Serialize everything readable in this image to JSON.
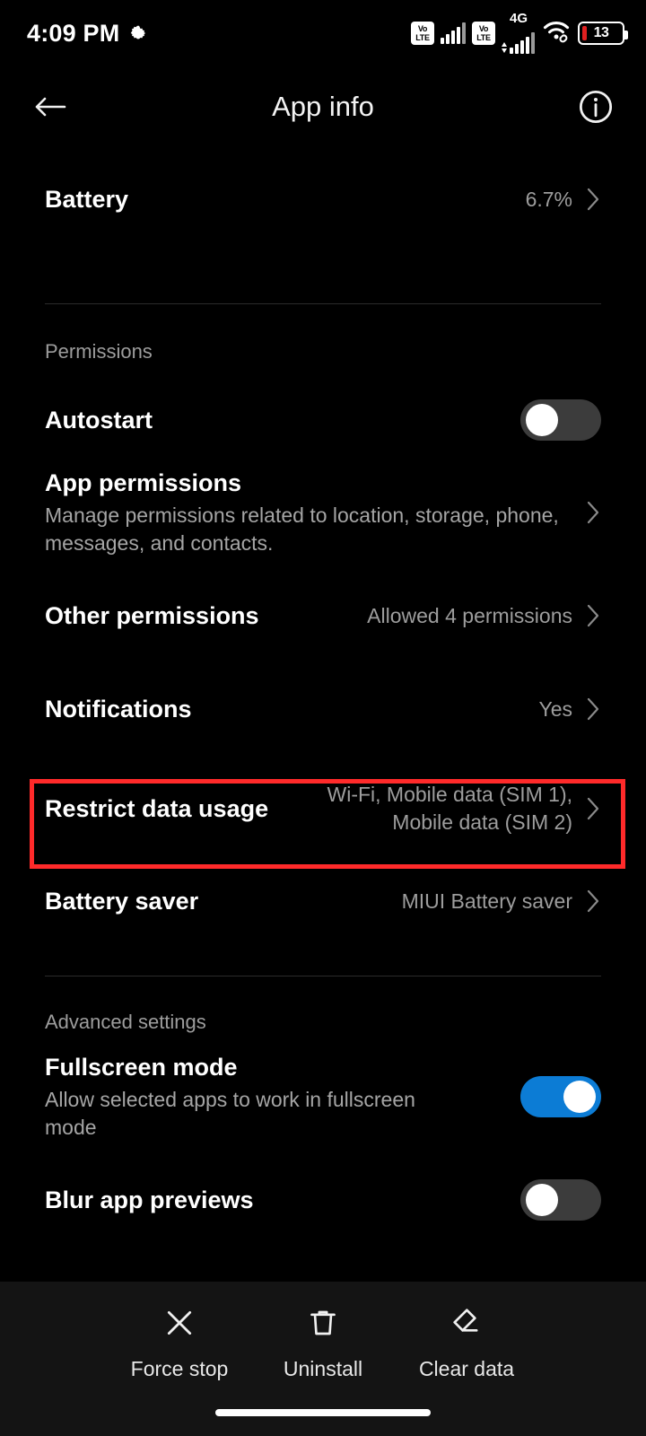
{
  "status_bar": {
    "time": "4:09 PM",
    "gear_icon": "gear-icon",
    "volte_top": "Vo",
    "volte_bottom": "LTE",
    "network_type": "4G",
    "battery_level": "13",
    "wifi_icon": "wifi-icon",
    "signal_icon": "signal-bars-icon"
  },
  "header": {
    "back_icon": "back-arrow-icon",
    "title": "App info",
    "info_icon": "info-icon"
  },
  "sections": {
    "permissions_label": "Permissions",
    "advanced_label": "Advanced settings"
  },
  "rows": {
    "battery": {
      "title": "Battery",
      "value": "6.7%"
    },
    "autostart": {
      "title": "Autostart",
      "toggle": "off"
    },
    "app_permissions": {
      "title": "App permissions",
      "subtitle": "Manage permissions related to location, storage, phone, messages, and contacts."
    },
    "other_permissions": {
      "title": "Other permissions",
      "value": "Allowed 4 permissions"
    },
    "notifications": {
      "title": "Notifications",
      "value": "Yes"
    },
    "restrict_data_usage": {
      "title": "Restrict data usage",
      "value": "Wi-Fi, Mobile data (SIM 1), Mobile data (SIM 2)"
    },
    "battery_saver": {
      "title": "Battery saver",
      "value": "MIUI Battery saver"
    },
    "fullscreen_mode": {
      "title": "Fullscreen mode",
      "subtitle": "Allow selected apps to work in fullscreen mode",
      "toggle": "on"
    },
    "blur_app_previews": {
      "title": "Blur app previews",
      "toggle": "off"
    }
  },
  "bottom_bar": {
    "force_stop": {
      "label": "Force stop",
      "icon": "close-x-icon"
    },
    "uninstall": {
      "label": "Uninstall",
      "icon": "trash-icon"
    },
    "clear_data": {
      "label": "Clear data",
      "icon": "eraser-icon"
    }
  },
  "annotation": {
    "highlight_color": "#ff2a2a",
    "target": "restrict-data-usage-row"
  },
  "colors": {
    "accent_on": "#0c7cd5",
    "toggle_off": "#3c3c3c",
    "background": "#000000",
    "bottom_bar": "#141414"
  }
}
